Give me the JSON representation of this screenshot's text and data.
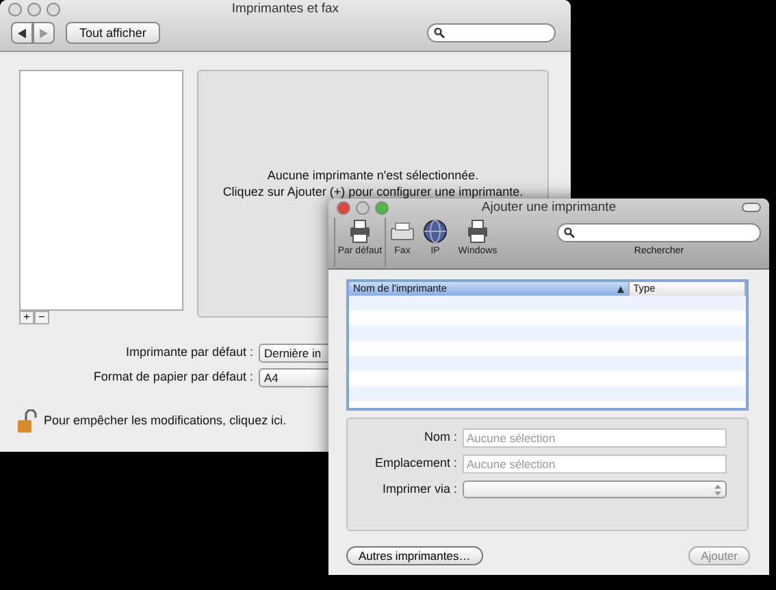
{
  "main_window": {
    "title": "Imprimantes et fax",
    "show_all_button": "Tout afficher",
    "list_buttons": [
      "+",
      "−"
    ],
    "message": [
      "Aucune imprimante n'est sélectionnée.",
      "Cliquez sur Ajouter (+) pour configurer une imprimante."
    ],
    "settings": [
      {
        "label": "Imprimante par défaut :",
        "value": "Dernière in"
      },
      {
        "label": "Format de papier par défaut :",
        "value": "A4"
      }
    ],
    "lock_text": "Pour empêcher les modifications, cliquez ici."
  },
  "dialog": {
    "title": "Ajouter une imprimante",
    "toolbar": [
      {
        "label": "Par défaut",
        "kind": "printer",
        "selected": true
      },
      {
        "label": "Fax",
        "kind": "fax",
        "selected": false
      },
      {
        "label": "IP",
        "kind": "globe",
        "selected": false
      },
      {
        "label": "Windows",
        "kind": "printer",
        "selected": false
      }
    ],
    "search_label": "Rechercher",
    "table": {
      "columns": [
        {
          "label": "Nom de l'imprimante",
          "selected": true
        },
        {
          "label": "Type",
          "selected": false
        }
      ]
    },
    "fields": [
      {
        "label": "Nom :",
        "kind": "text",
        "placeholder": "Aucune sélection"
      },
      {
        "label": "Emplacement :",
        "kind": "text",
        "placeholder": "Aucune sélection"
      },
      {
        "label": "Imprimer via :",
        "kind": "select"
      }
    ],
    "buttons": [
      {
        "label": "Autres imprimantes…",
        "disabled": false
      },
      {
        "label": "Ajouter",
        "disabled": true
      }
    ]
  }
}
